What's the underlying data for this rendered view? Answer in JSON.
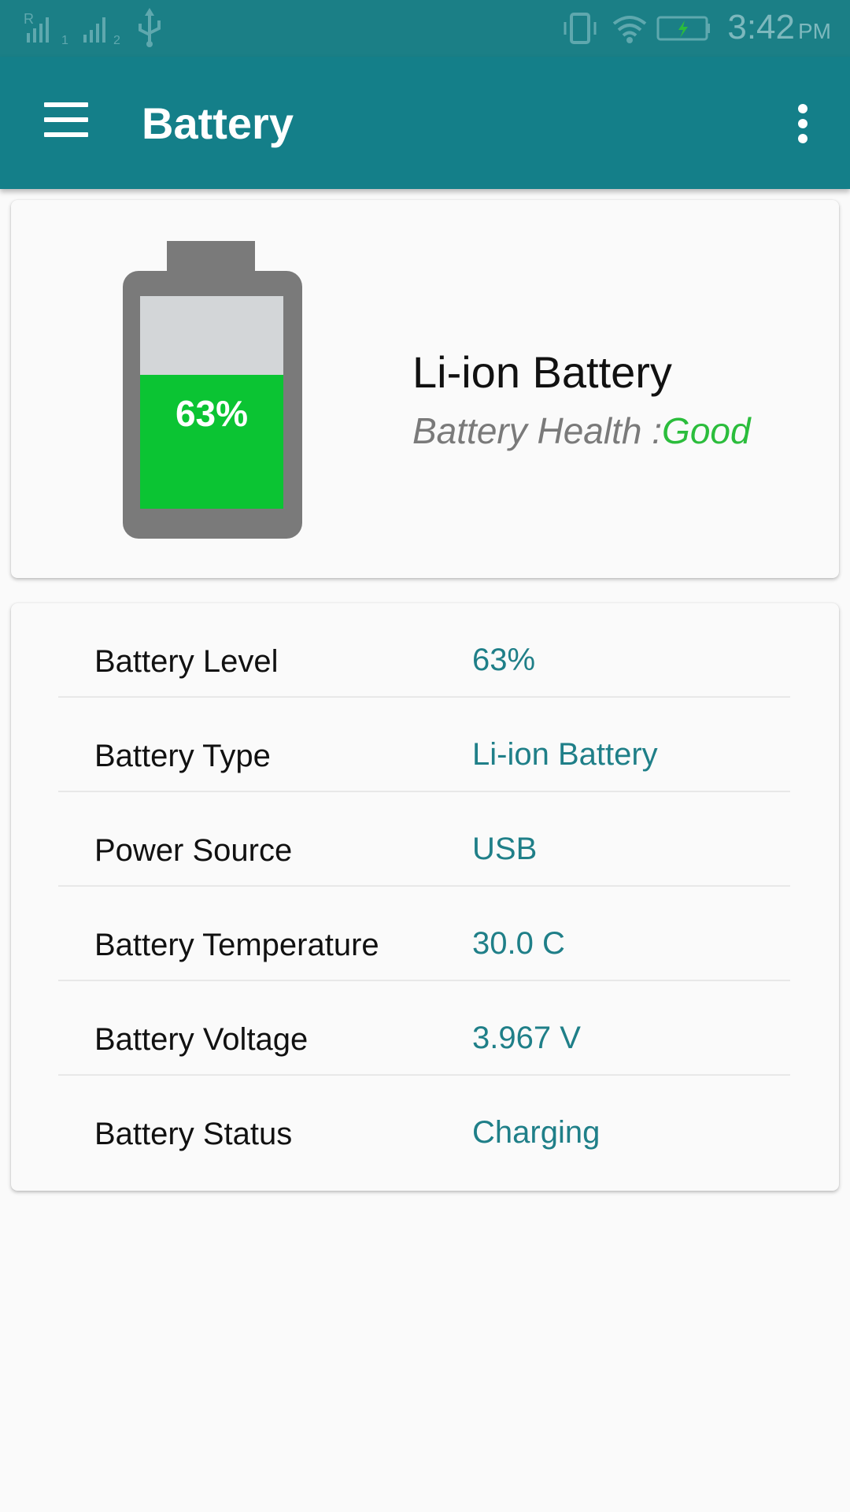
{
  "status_bar": {
    "time": "3:42",
    "ampm": "PM",
    "icons": [
      "signal-sim1-icon",
      "signal-sim2-icon",
      "usb-icon",
      "vibrate-icon",
      "wifi-icon",
      "battery-charging-icon"
    ],
    "sim1_label": "1",
    "sim2_label": "2",
    "roaming_label": "R"
  },
  "app_bar": {
    "title": "Battery",
    "menu_icon": "hamburger-menu-icon",
    "overflow_icon": "more-vert-icon"
  },
  "summary": {
    "battery_name": "Li-ion Battery",
    "health_label": "Battery Health :",
    "health_value": "Good",
    "level_text": "63%",
    "level_fraction": 0.63,
    "colors": {
      "fill": "#0bc433",
      "empty": "#d3d6d8",
      "casing": "#7a7a7a",
      "health_good": "#2bbd3c"
    }
  },
  "details": {
    "rows": [
      {
        "label": "Battery Level",
        "value": "63%"
      },
      {
        "label": "Battery Type",
        "value": "Li-ion Battery"
      },
      {
        "label": "Power Source",
        "value": "USB"
      },
      {
        "label": "Battery Temperature",
        "value": "30.0 C"
      },
      {
        "label": "Battery Voltage",
        "value": "3.967 V"
      },
      {
        "label": "Battery Status",
        "value": "Charging"
      }
    ]
  },
  "theme": {
    "primary": "#147f89",
    "value_color": "#1f7f88"
  }
}
